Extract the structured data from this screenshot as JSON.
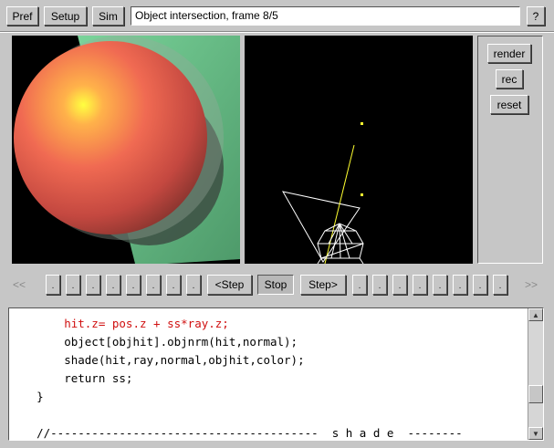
{
  "toolbar": {
    "pref_label": "Pref",
    "setup_label": "Setup",
    "sim_label": "Sim",
    "title_text": "Object intersection, frame 8/5",
    "help_label": "?"
  },
  "controls": {
    "render_label": "render",
    "rec_label": "rec",
    "reset_label": "reset"
  },
  "nav": {
    "rewind_label": "<<",
    "forward_label": ">>",
    "dot": ".",
    "step_back_label": "<Step",
    "stop_label": "Stop",
    "step_fwd_label": "Step>"
  },
  "code": {
    "lines": [
      {
        "text": "        hit.z= pos.z + ss*ray.z;",
        "color": "#d01010"
      },
      {
        "text": "        object[objhit].objnrm(hit,normal);",
        "color": "#000000"
      },
      {
        "text": "        shade(hit,ray,normal,objhit,color);",
        "color": "#000000"
      },
      {
        "text": "        return ss;",
        "color": "#000000"
      },
      {
        "text": "    }",
        "color": "#000000"
      },
      {
        "text": "",
        "color": "#000000"
      },
      {
        "text": "    //---------------------------------------  s h a d e  --------",
        "color": "#000000"
      }
    ]
  },
  "icons": {
    "scroll_up": "arrow-up-icon",
    "scroll_down": "arrow-down-icon"
  }
}
